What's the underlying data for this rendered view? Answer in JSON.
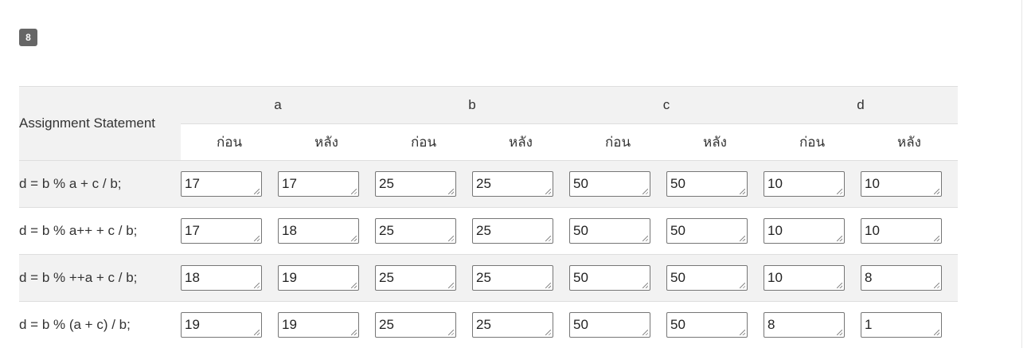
{
  "question_number": "8",
  "table": {
    "statement_header": "Assignment Statement",
    "variables": [
      "a",
      "b",
      "c",
      "d"
    ],
    "before_label": "ก่อน",
    "after_label": "หลัง",
    "rows": [
      {
        "statement": "d = b % a + c / b;",
        "values": [
          "17",
          "17",
          "25",
          "25",
          "50",
          "50",
          "10",
          "10"
        ]
      },
      {
        "statement": "d = b % a++ + c / b;",
        "values": [
          "17",
          "18",
          "25",
          "25",
          "50",
          "50",
          "10",
          "10"
        ]
      },
      {
        "statement": "d = b % ++a + c / b;",
        "values": [
          "18",
          "19",
          "25",
          "25",
          "50",
          "50",
          "10",
          "8"
        ]
      },
      {
        "statement": "d = b % (a + c) / b;",
        "values": [
          "19",
          "19",
          "25",
          "25",
          "50",
          "50",
          "8",
          "1"
        ]
      }
    ]
  }
}
